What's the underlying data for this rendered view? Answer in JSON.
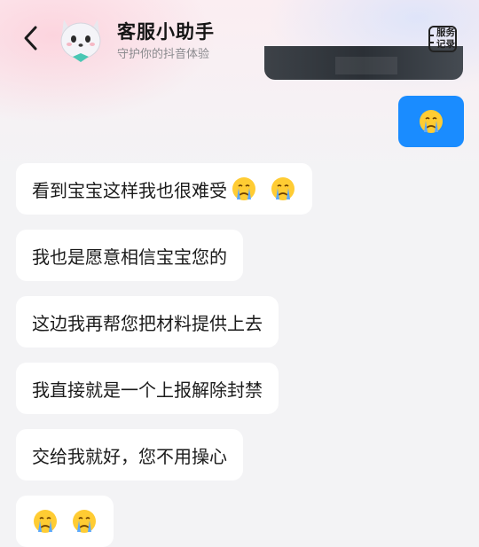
{
  "header": {
    "title": "客服小助手",
    "subtitle": "守护你的抖音体验",
    "service_line1": "服务",
    "service_line2": "记录"
  },
  "messages": [
    {
      "from": "me",
      "type": "emoji",
      "emojis": [
        "crying-face"
      ]
    },
    {
      "from": "agent",
      "text": "看到宝宝这样我也很难受",
      "emojis": [
        "crying-face",
        "crying-face"
      ]
    },
    {
      "from": "agent",
      "text": "我也是愿意相信宝宝您的"
    },
    {
      "from": "agent",
      "text": "这边我再帮您把材料提供上去"
    },
    {
      "from": "agent",
      "text": "我直接就是一个上报解除封禁"
    },
    {
      "from": "agent",
      "text": "交给我就好，您不用操心"
    },
    {
      "from": "agent",
      "type": "emoji",
      "emojis": [
        "crying-face",
        "crying-face"
      ]
    }
  ],
  "colors": {
    "my_bubble": "#1a8cff",
    "agent_bubble": "#ffffff"
  }
}
